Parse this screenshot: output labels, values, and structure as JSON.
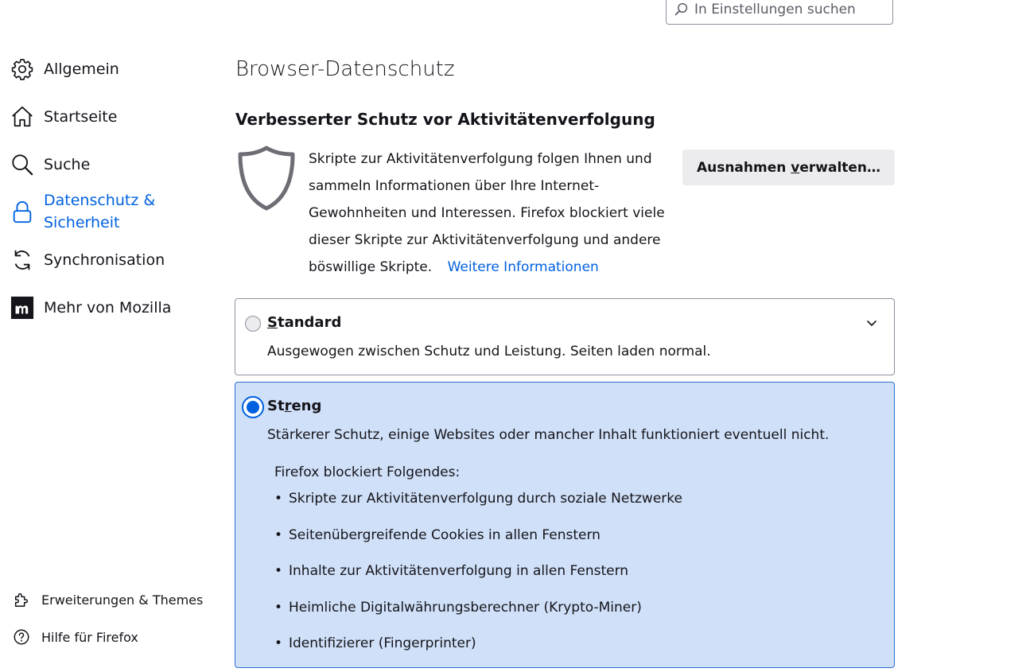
{
  "search": {
    "placeholder": "In Einstellungen suchen"
  },
  "sidebar": {
    "items": [
      {
        "label": "Allgemein",
        "icon": "gear-icon"
      },
      {
        "label": "Startseite",
        "icon": "home-icon"
      },
      {
        "label": "Suche",
        "icon": "search-icon"
      },
      {
        "label": "Datenschutz &",
        "label2": "Sicherheit",
        "icon": "lock-icon",
        "active": true
      },
      {
        "label": "Synchronisation",
        "icon": "sync-icon"
      },
      {
        "label": "Mehr von Mozilla",
        "icon": "mozilla-icon"
      }
    ],
    "bottom": [
      {
        "label": "Erweiterungen & Themes",
        "icon": "puzzle-icon"
      },
      {
        "label": "Hilfe für Firefox",
        "icon": "help-icon"
      }
    ]
  },
  "main": {
    "title": "Browser-Datenschutz",
    "etp": {
      "heading": "Verbesserter Schutz vor Aktivitätenverfolgung",
      "description": "Skripte zur Aktivitätenverfolgung folgen Ihnen und sammeln Informationen über Ihre Internet-Gewohnheiten und Interessen. Firefox blockiert viele dieser Skripte zur Aktivitätenverfolgung und andere böswillige Skripte.",
      "learn_more": "Weitere Informationen",
      "exceptions_button_pre": "Ausnahmen ",
      "exceptions_button_key": "v",
      "exceptions_button_post": "erwalten…"
    },
    "standard": {
      "title_key": "S",
      "title_rest": "tandard",
      "description": "Ausgewogen zwischen Schutz und Leistung. Seiten laden normal.",
      "selected": false
    },
    "strict": {
      "title_pre": "St",
      "title_key": "r",
      "title_post": "eng",
      "description": "Stärkerer Schutz, einige Websites oder mancher Inhalt funktioniert eventuell nicht.",
      "selected": true,
      "blocks_heading": "Firefox blockiert Folgendes:",
      "blocks": [
        "Skripte zur Aktivitätenverfolgung durch soziale Netzwerke",
        "Seitenübergreifende Cookies in allen Fenstern",
        "Inhalte zur Aktivitätenverfolgung in allen Fenstern",
        "Heimliche Digitalwährungsberechner (Krypto-Miner)",
        "Identifizierer (Fingerprinter)"
      ]
    }
  },
  "colors": {
    "accent": "#0061e0",
    "selected_card_bg": "#cfe0f8",
    "button_bg": "#ececee"
  }
}
